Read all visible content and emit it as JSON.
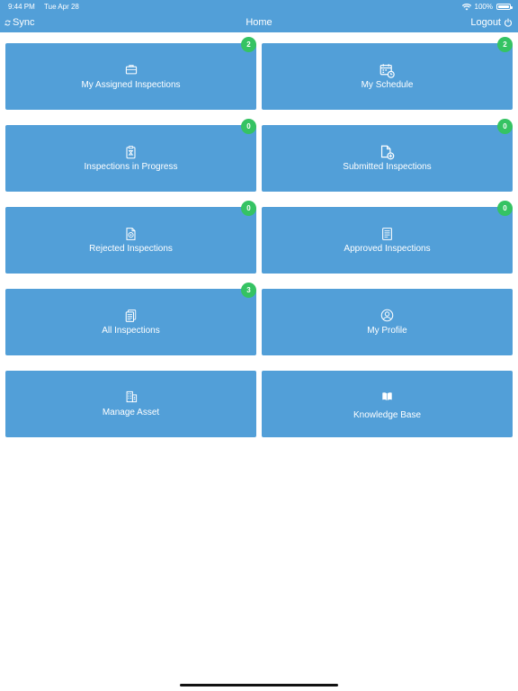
{
  "status_bar": {
    "time": "9:44 PM",
    "date": "Tue Apr 28",
    "battery": "100%"
  },
  "nav": {
    "sync_label": "Sync",
    "title": "Home",
    "logout_label": "Logout"
  },
  "tiles": [
    {
      "label": "My Assigned Inspections",
      "badge": "2",
      "icon": "briefcase-icon"
    },
    {
      "label": "My Schedule",
      "badge": "2",
      "icon": "calendar-icon"
    },
    {
      "label": "Inspections in Progress",
      "badge": "0",
      "icon": "hourglass-clipboard-icon"
    },
    {
      "label": "Submitted Inspections",
      "badge": "0",
      "icon": "document-add-icon"
    },
    {
      "label": "Rejected Inspections",
      "badge": "0",
      "icon": "document-rejected-icon"
    },
    {
      "label": "Approved Inspections",
      "badge": "0",
      "icon": "checklist-icon"
    },
    {
      "label": "All Inspections",
      "badge": "3",
      "icon": "document-stack-icon"
    },
    {
      "label": "My Profile",
      "icon": "user-circle-icon"
    },
    {
      "label": "Manage Asset",
      "icon": "building-icon"
    },
    {
      "label": "Knowledge Base",
      "icon": "book-icon"
    }
  ],
  "colors": {
    "primary": "#529fd8",
    "badge": "#35c363",
    "background": "#ffffff"
  }
}
